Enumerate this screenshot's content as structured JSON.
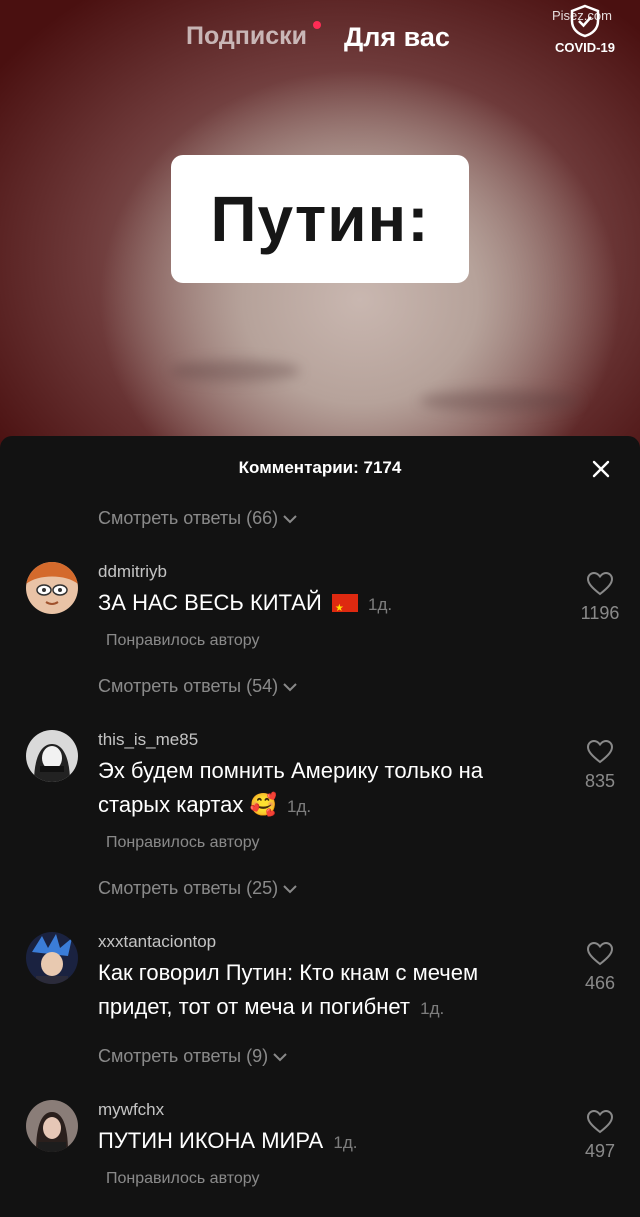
{
  "top_nav": {
    "following": "Подписки",
    "for_you": "Для вас",
    "covid_label": "COVID-19",
    "watermark": "Pisez.com"
  },
  "video": {
    "caption": "Путин:"
  },
  "comments_sheet": {
    "title": "Комментарии: 7174",
    "view_replies_top": "Смотреть ответы (66)",
    "comments": [
      {
        "username": "ddmitriyb",
        "text": "ЗА НАС ВЕСЬ КИТАЙ",
        "date": "1д.",
        "liked_by_author": "Понравилось автору",
        "likes": "1196",
        "view_replies": "Смотреть ответы (54)"
      },
      {
        "username": "this_is_me85",
        "text": "Эх будем помнить Америку только на старых картах",
        "date": "1д.",
        "liked_by_author": "Понравилось автору",
        "likes": "835",
        "view_replies": "Смотреть ответы (25)"
      },
      {
        "username": "xxxtantaciontop",
        "text": "Как говорил Путин: Кто кнам с мечем придет, тот от меча и погибнет",
        "date": "1д.",
        "likes": "466",
        "view_replies": "Смотреть ответы (9)"
      },
      {
        "username": "mywfchx",
        "text": "ПУТИН ИКОНА МИРА",
        "date": "1д.",
        "liked_by_author": "Понравилось автору",
        "likes": "497"
      }
    ]
  },
  "colors": {
    "sheet_bg": "#121212",
    "accent_dot": "#fe2c55",
    "text_primary": "#ffffff"
  }
}
